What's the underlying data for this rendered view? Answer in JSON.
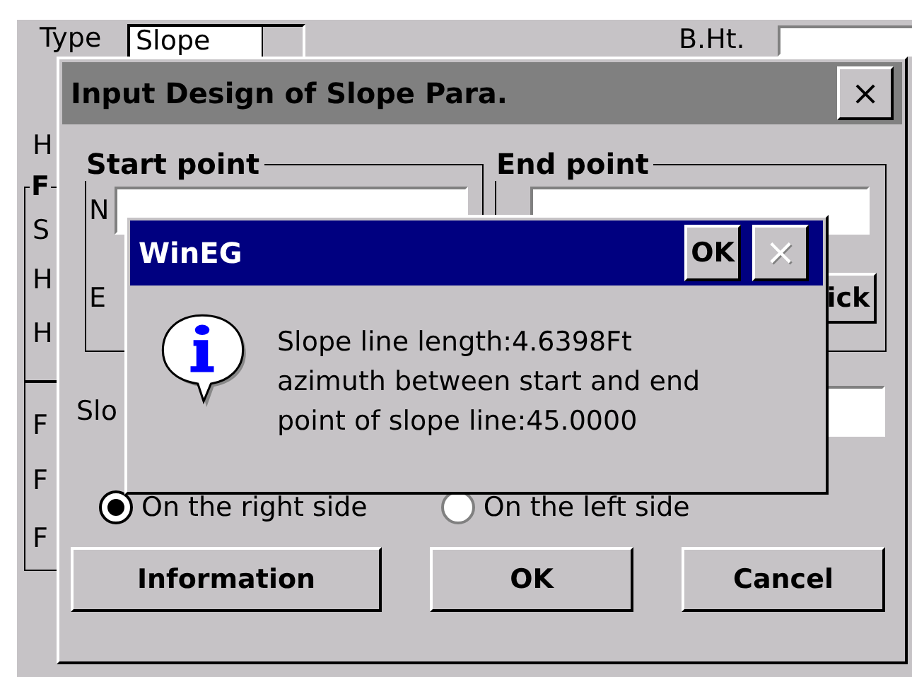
{
  "background_window": {
    "type_label": "Type",
    "type_value": "Slope",
    "bht_label": "B.Ht.",
    "top_label": "H",
    "group_title": "F",
    "group_labels": [
      "S",
      "H",
      "H"
    ],
    "lower_labels": [
      "F",
      "F",
      "F"
    ]
  },
  "dialog": {
    "title": "Input Design of Slope Para.",
    "close": "×",
    "start_group": {
      "title": "Start point",
      "n_label": "N",
      "e_label": "E"
    },
    "end_group": {
      "title": "End point",
      "pick_button": "ick"
    },
    "slope_label": "Slo",
    "radios": [
      {
        "label": "On the right side",
        "selected": true
      },
      {
        "label": "On the left side",
        "selected": false
      }
    ],
    "buttons": [
      "Information",
      "OK",
      "Cancel"
    ]
  },
  "message_box": {
    "title": "WinEG",
    "ok_button": "OK",
    "close": "×",
    "close_disabled": true,
    "lines": [
      "Slope line length:4.6398Ft",
      "azimuth between start and end",
      "point of slope line:45.0000"
    ]
  }
}
